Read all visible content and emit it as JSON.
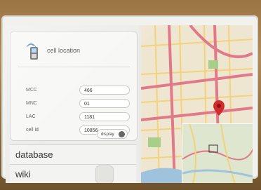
{
  "app": {
    "title": "cell location"
  },
  "fields": [
    {
      "label": "MCC",
      "value": "466"
    },
    {
      "label": "MNC",
      "value": "01"
    },
    {
      "label": "LAC",
      "value": "1181"
    },
    {
      "label": "cell id",
      "value": "10856"
    }
  ],
  "actions": {
    "display_label": "display"
  },
  "sections": [
    {
      "label": "database"
    },
    {
      "label": "wiki"
    }
  ],
  "icons": {
    "header": "phone-icon",
    "display": "search-icon",
    "map_marker": "location-pin-icon"
  },
  "colors": {
    "pin": "#d22b2b",
    "road_major": "#e07a8a",
    "road_minor": "#f2d27a",
    "water": "#9fc3dc",
    "park": "#a8cf8a"
  }
}
